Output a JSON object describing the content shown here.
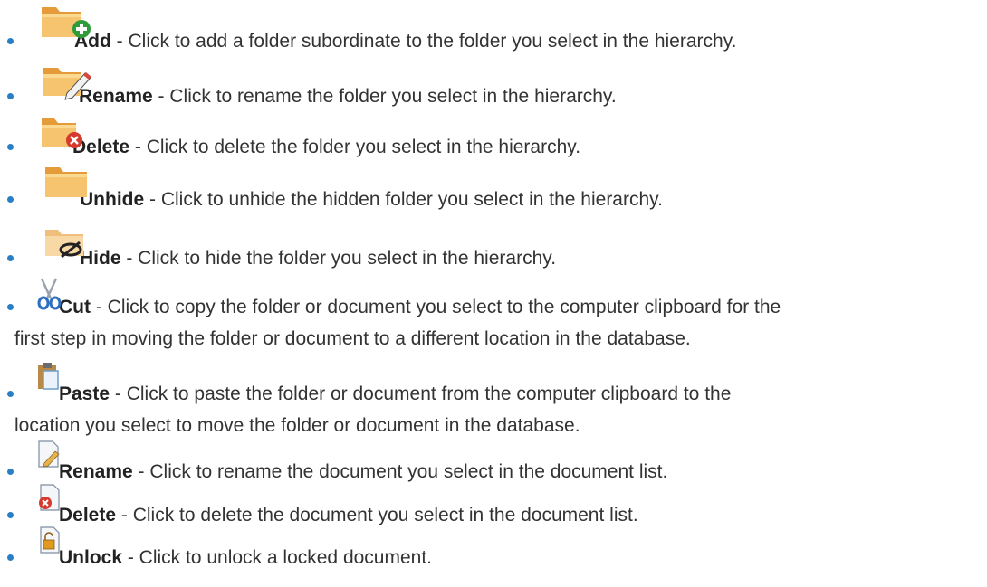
{
  "items": [
    {
      "icon": "folder-add-icon",
      "name": "Add",
      "desc": " - Click to add a folder subordinate to the folder you select in the hierarchy."
    },
    {
      "icon": "folder-rename-icon",
      "name": "Rename",
      "desc": " - Click to rename the folder you select in the hierarchy."
    },
    {
      "icon": "folder-delete-icon",
      "name": "Delete",
      "desc": " - Click to delete the folder you select in the hierarchy."
    },
    {
      "icon": "folder-unhide-icon",
      "name": "Unhide",
      "desc": " - Click to unhide the hidden folder you select in the hierarchy."
    },
    {
      "icon": "folder-hide-icon",
      "name": "Hide",
      "desc": " - Click to hide the folder you select in the hierarchy."
    },
    {
      "icon": "scissors-cut-icon",
      "name": "Cut",
      "desc": " - Click to copy the folder or document you select to the computer clipboard for the",
      "desc2": "first step in moving the folder or document to a different location in the database."
    },
    {
      "icon": "clipboard-paste-icon",
      "name": "Paste",
      "desc": " - Click to paste the folder or document from the computer clipboard to the",
      "desc2": "location you select to move the folder or document in the database."
    },
    {
      "icon": "document-rename-icon",
      "name": "Rename",
      "desc": " - Click to rename the document you select in the document list."
    },
    {
      "icon": "document-delete-icon",
      "name": "Delete",
      "desc": " - Click to delete the document you select in the document list."
    },
    {
      "icon": "document-unlock-icon",
      "name": "Unlock",
      "desc": " - Click to unlock a locked document."
    }
  ]
}
